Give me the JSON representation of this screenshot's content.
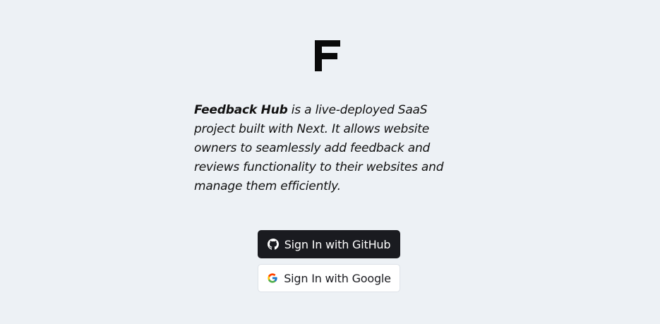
{
  "logo": {
    "letter": "F",
    "icon": "f-logo-icon"
  },
  "description": {
    "brand": "Feedback Hub",
    "text": " is a live-deployed SaaS project built with Next. It allows website owners to seamlessly add feedback and reviews functionality to their websites and manage them efficiently."
  },
  "auth": {
    "github_label": "Sign In with GitHub",
    "github_icon": "github-icon",
    "google_label": "Sign In with Google",
    "google_icon": "google-icon"
  },
  "colors": {
    "background": "#edf1f5",
    "github_button_bg": "#1a1b20",
    "google_button_bg": "#ffffff"
  }
}
